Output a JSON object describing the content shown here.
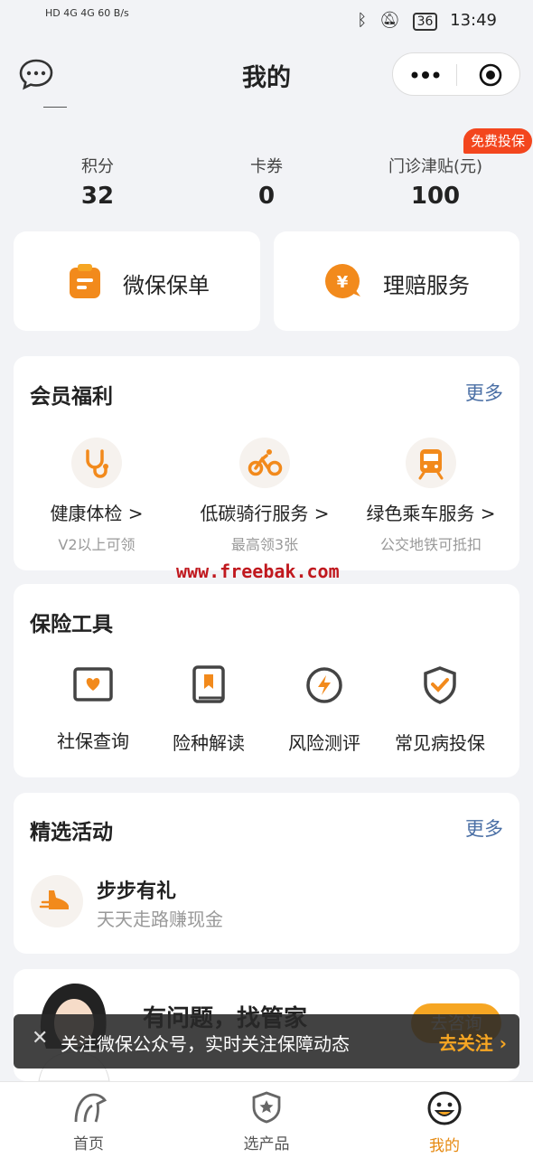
{
  "status_bar": {
    "left_text": "HD 4G 4G 60 B/s",
    "battery": "36",
    "time": "13:49"
  },
  "nav": {
    "title": "我的"
  },
  "stats": [
    {
      "label": "积分",
      "value": "32"
    },
    {
      "label": "卡券",
      "value": "0"
    },
    {
      "label": "门诊津贴(元)",
      "value": "100"
    }
  ],
  "badge": "免费投保",
  "quick": {
    "policy": "微保保单",
    "claims": "理赔服务"
  },
  "member": {
    "title": "会员福利",
    "more": "更多",
    "items": [
      {
        "title": "健康体检 >",
        "sub": "V2以上可领"
      },
      {
        "title": "低碳骑行服务 >",
        "sub": "最高领3张"
      },
      {
        "title": "绿色乘车服务 >",
        "sub": "公交地铁可抵扣"
      }
    ]
  },
  "watermark": "www.freebak.com",
  "tools": {
    "title": "保险工具",
    "items": [
      "社保查询",
      "险种解读",
      "风险测评",
      "常见病投保"
    ]
  },
  "activity": {
    "title": "精选活动",
    "more": "更多",
    "item_title": "步步有礼",
    "item_sub": "天天走路赚现金"
  },
  "butler": {
    "title": "有问题，找管家",
    "button": "去咨询"
  },
  "toast": {
    "message": "关注微保公众号，实时关注保障动态",
    "action": "去关注"
  },
  "tabs": [
    "首页",
    "选产品",
    "我的"
  ],
  "colors": {
    "accent": "#f6a623",
    "badge": "#f3461e",
    "link": "#4a6fa5"
  }
}
